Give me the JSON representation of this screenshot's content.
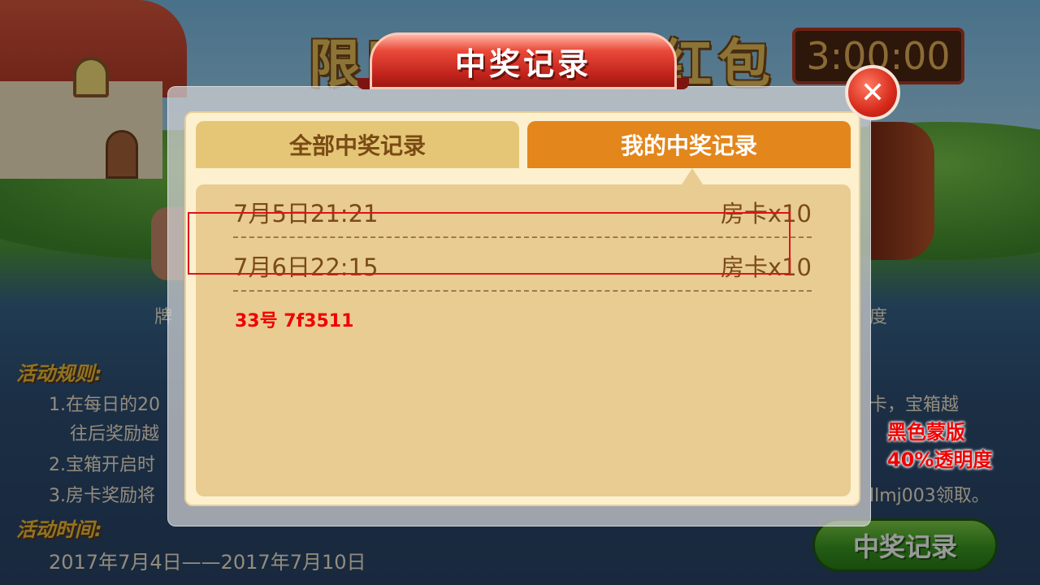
{
  "background": {
    "title": "限时开宝箱领红包",
    "timer": "3:00:00",
    "left_frag": "牌",
    "right_frag": "度",
    "rules_heading": "活动规则:",
    "rule_1a": "1.在每日的20",
    "rule_1a_tail": "卡，宝箱越",
    "rule_1b": "往后奖励越",
    "rule_2": "2.宝箱开启时",
    "rule_3": "3.房卡奖励将",
    "rule_3_tail": "llmj003领取。",
    "time_heading": "活动时间:",
    "time_value": "2017年7月4日——2017年7月10日",
    "records_button": "中奖记录"
  },
  "dialog": {
    "title": "中奖记录",
    "tabs": [
      {
        "label": "全部中奖记录",
        "active": false
      },
      {
        "label": "我的中奖记录",
        "active": true
      }
    ],
    "records": [
      {
        "time": "7月5日21:21",
        "reward": "房卡x10"
      },
      {
        "time": "7月6日22:15",
        "reward": "房卡x10"
      }
    ],
    "note": "33号 7f3511"
  },
  "annotations": {
    "mask_line1": "黑色蒙版",
    "mask_line2": "40%透明度"
  },
  "colors": {
    "tab_active": "#e3861c",
    "tab_inactive": "#e4c676",
    "record_text": "#7a4a1a",
    "annotation_red": "#f00000"
  }
}
